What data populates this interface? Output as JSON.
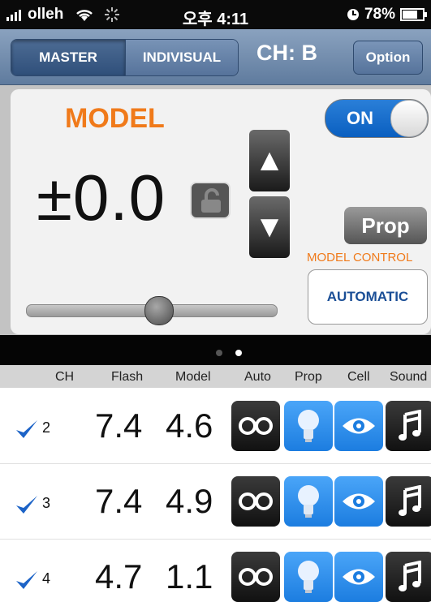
{
  "status": {
    "carrier": "olleh",
    "time": "오후 4:11",
    "battery": "78%"
  },
  "nav": {
    "master_label": "MASTER",
    "indivisual_label": "INDIVISUAL",
    "channel": "CH: B",
    "option_label": "Option"
  },
  "panel": {
    "model_label": "MODEL",
    "value": "±0.0",
    "toggle_label": "ON",
    "prop_label": "Prop",
    "model_control_label": "MODEL CONTROL",
    "automatic_label": "AUTOMATIC",
    "up_symbol": "▲",
    "down_symbol": "▼"
  },
  "pager": {
    "count": 2,
    "active": 2
  },
  "table": {
    "headers": {
      "ch": "CH",
      "flash": "Flash",
      "model": "Model",
      "auto": "Auto",
      "prop": "Prop",
      "cell": "Cell",
      "sound": "Sound"
    },
    "rows": [
      {
        "ch": "2",
        "flash": "7.4",
        "model": "4.6"
      },
      {
        "ch": "3",
        "flash": "7.4",
        "model": "4.9"
      },
      {
        "ch": "4",
        "flash": "4.7",
        "model": "1.1"
      }
    ]
  },
  "icons": {
    "auto": "infinity-icon",
    "prop": "lightbulb-icon",
    "cell": "eye-icon",
    "sound": "music-note-icon",
    "check": "checkmark-icon"
  },
  "colors": {
    "accent_orange": "#f07a1a",
    "nav_blue": "#5f7b9e",
    "toggle_blue": "#0a5fc0",
    "icon_blue": "#1c7de0"
  }
}
